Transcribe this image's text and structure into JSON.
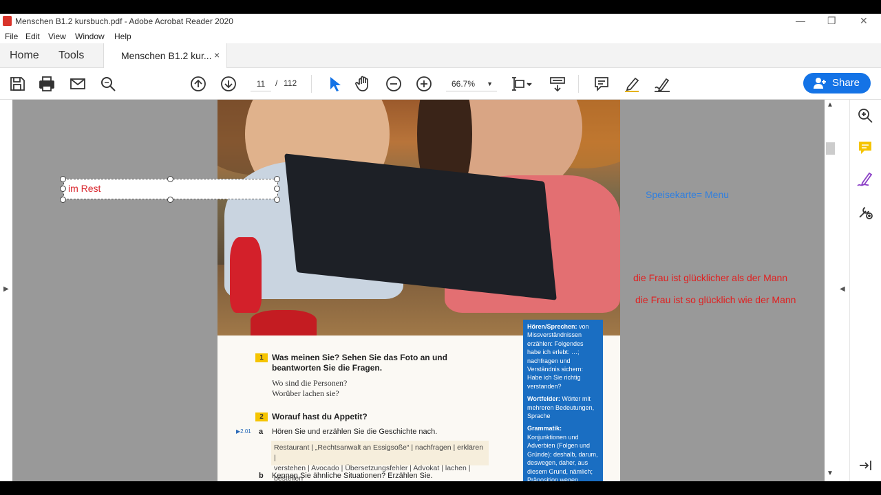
{
  "window": {
    "title": "Menschen B1.2 kursbuch.pdf - Adobe Acrobat Reader 2020",
    "minimize": "—",
    "restore": "❐",
    "close": "✕"
  },
  "menu": [
    "File",
    "Edit",
    "View",
    "Window",
    "Help"
  ],
  "tabs": {
    "home": "Home",
    "tools": "Tools",
    "document": "Menschen B1.2 kur...",
    "close": "×"
  },
  "toolbar": {
    "page_current": "11",
    "page_sep": "/",
    "page_total": "112",
    "zoom": "66.7%",
    "share": "Share"
  },
  "colors": {
    "accent": "#1473e6",
    "annotation_red": "#e02020",
    "annotation_blue": "#2f7fe0",
    "canvas": "#999999"
  },
  "annotations": {
    "textbox": "im Rest",
    "speisekarte": "Speisekarte= Menu",
    "line1": "die Frau ist glücklicher als der Mann",
    "line2": "die Frau ist so glücklich wie der Mann"
  },
  "page": {
    "ex1_num": "1",
    "ex1_title_l1": "Was meinen Sie? Sehen Sie das Foto an und",
    "ex1_title_l2": "beantworten Sie die Fragen.",
    "ex1_q1": "Wo sind die Personen?",
    "ex1_q2": "Worüber lachen sie?",
    "ex2_num": "2",
    "ex2_title": "Worauf hast du Appetit?",
    "audio": "▶2.01",
    "ex2a_letter": "a",
    "ex2a_text": "Hören Sie und erzählen Sie die Geschichte nach.",
    "words_l1": "Restaurant | „Rechtsanwalt an Essigsoße“ | nachfragen | erklären |",
    "words_l2": "verstehen | Avocado | Übersetzungsfehler | Advokat | lachen | bestellen",
    "ex2b_letter": "b",
    "ex2b_text": "Kennen Sie ähnliche Situationen? Erzählen Sie."
  },
  "sidebar_box": {
    "p1_bold": "Hören/Sprechen:",
    "p1_rest": " von Missverständnissen erzählen: Folgendes habe ich erlebt: …; nachfragen und Verständnis sichern: Habe ich Sie richtig verstanden?",
    "p2_bold": "Wortfelder:",
    "p2_rest": " Wörter mit mehreren Bedeutungen, Sprache",
    "p3_bold": "Grammatik:",
    "p3_rest": " Konjunktionen und Adverbien (Folgen und Gründe): deshalb, darum, deswegen, daher, aus diesem Grund, nämlich; Präposition wegen"
  }
}
